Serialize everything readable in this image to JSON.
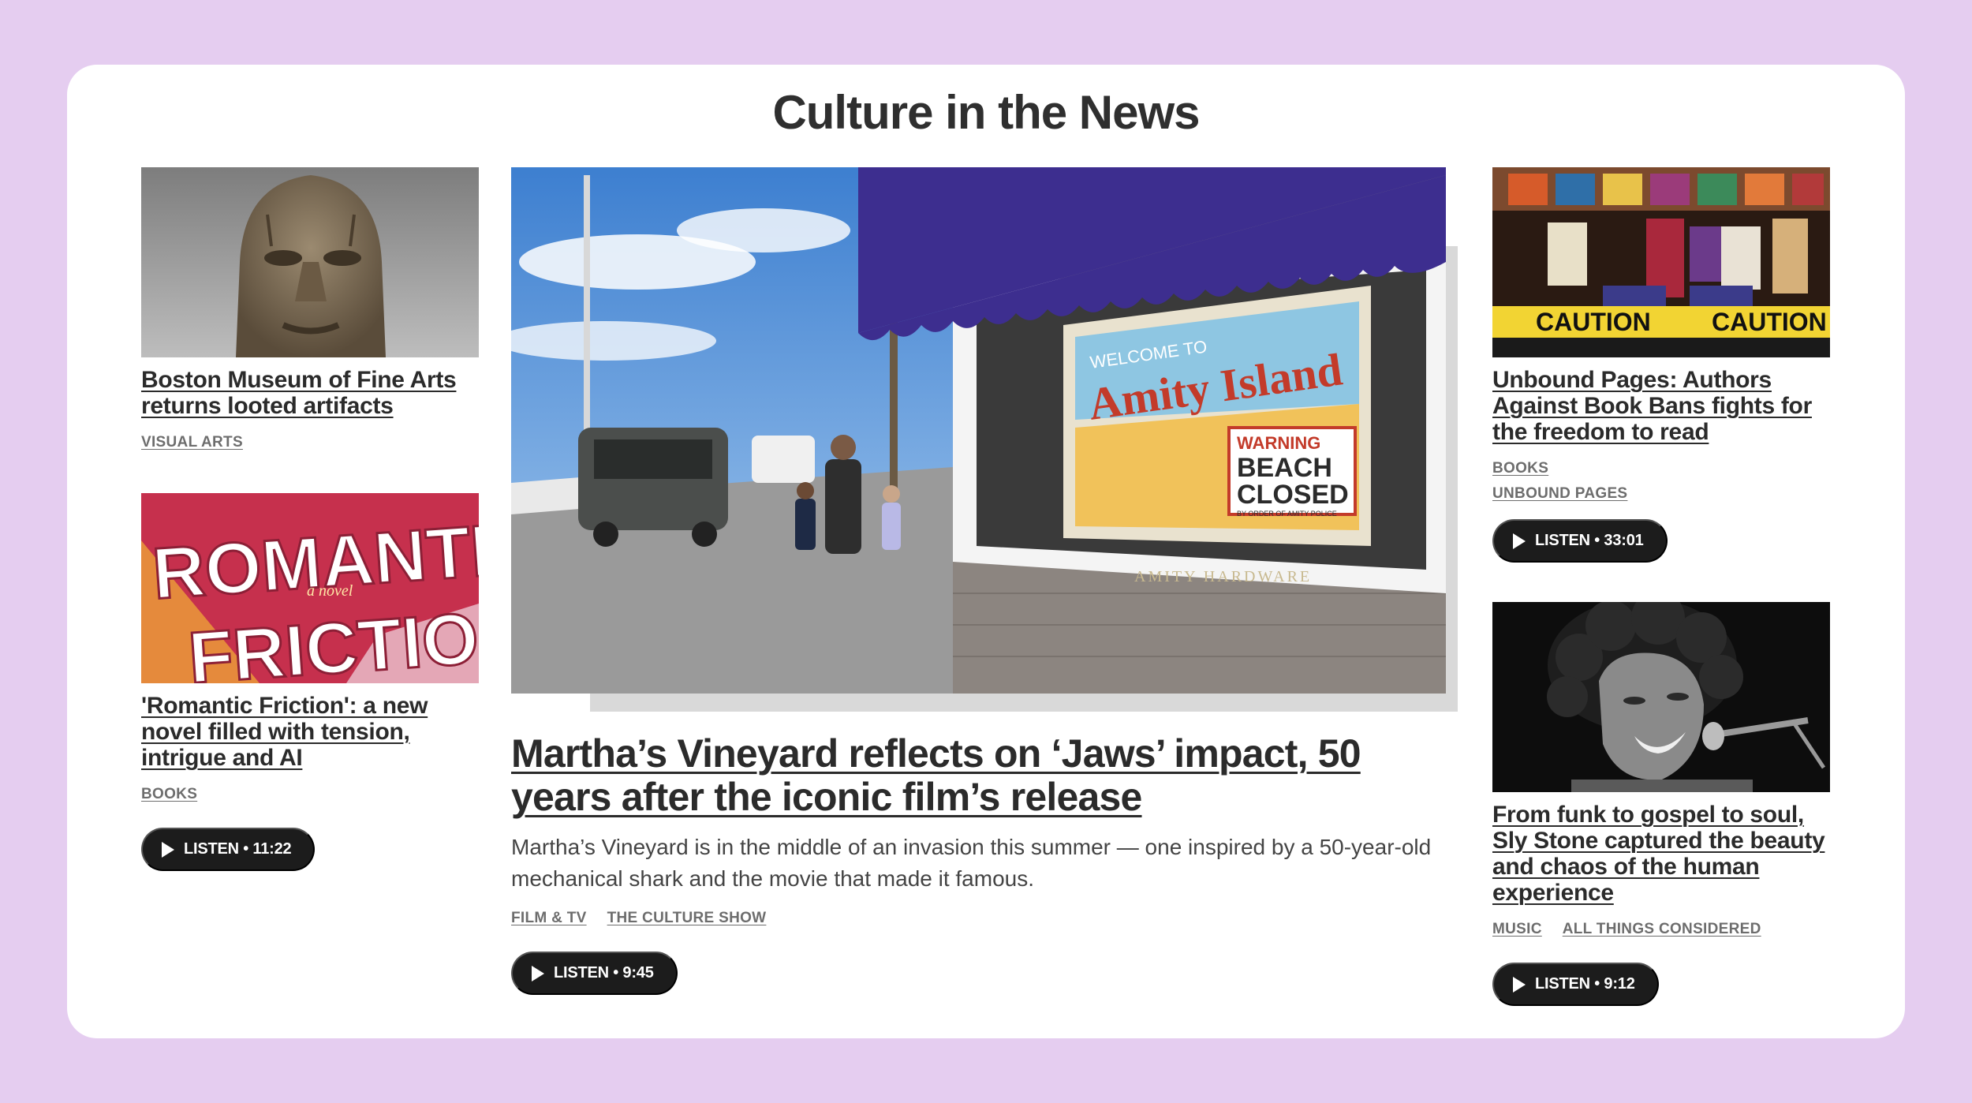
{
  "section_title": "Culture in the News",
  "left": [
    {
      "headline": "Boston Museum of Fine Arts returns looted artifacts",
      "tags": [
        "VISUAL ARTS"
      ]
    },
    {
      "headline": "'Romantic Friction': a new novel filled with tension, intrigue and AI",
      "tags": [
        "BOOKS"
      ],
      "listen": "LISTEN • 11:22",
      "cover_title_1": "ROMANTIC",
      "cover_subtitle": "a novel",
      "cover_title_2": "FRICTION"
    }
  ],
  "feature": {
    "headline": "Martha’s Vineyard reflects on ‘Jaws’ impact, 50 years after the iconic film’s release",
    "description": "Martha’s Vineyard is in the middle of an invasion this summer — one inspired by a 50-year-old mechanical shark and the movie that made it famous.",
    "tags": [
      "FILM & TV",
      "THE CULTURE SHOW"
    ],
    "listen": "LISTEN • 9:45",
    "sign_welcome": "WELCOME TO",
    "sign_title": "Amity Island",
    "sign_warning": "WARNING",
    "sign_beach": "BEACH",
    "sign_closed": "CLOSED",
    "sign_order": "BY ORDER OF AMITY POLICE",
    "store_name": "AMITY HARDWARE"
  },
  "right": [
    {
      "headline": "Unbound Pages: Authors Against Book Bans fights for the freedom to read",
      "tags": [
        "BOOKS",
        "UNBOUND PAGES"
      ],
      "listen": "LISTEN • 33:01",
      "caution_1": "CAUTION",
      "caution_2": "CAUTION"
    },
    {
      "headline": "From funk to gospel to soul, Sly Stone captured the beauty and chaos of the human experience",
      "tags": [
        "MUSIC",
        "ALL THINGS CONSIDERED"
      ],
      "listen": "LISTEN • 9:12"
    }
  ]
}
